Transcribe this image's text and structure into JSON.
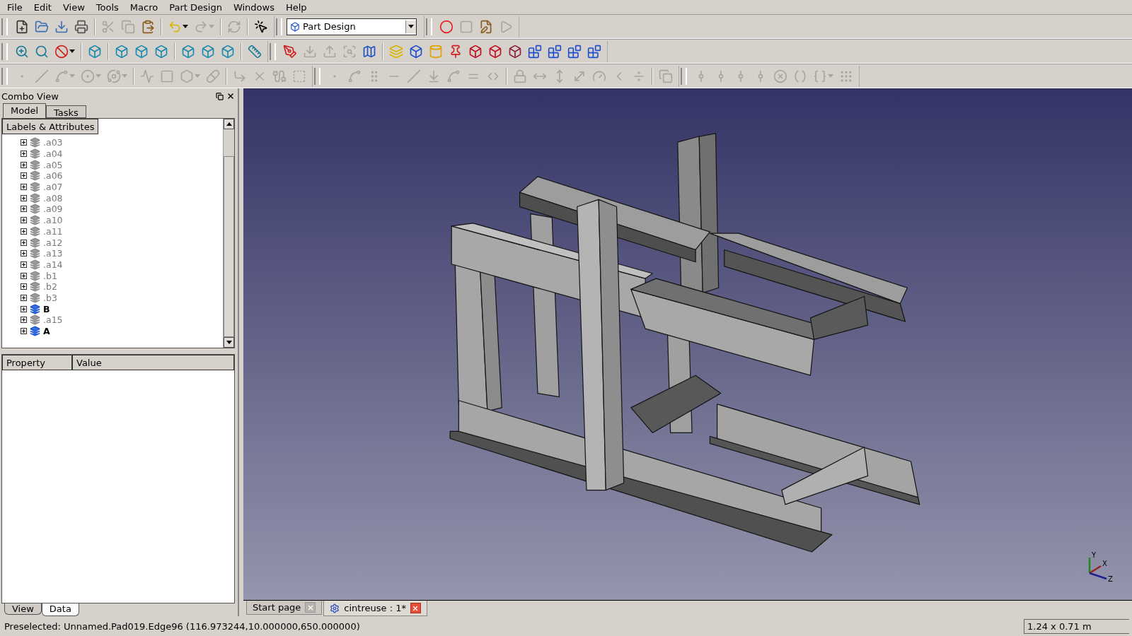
{
  "menu": [
    "File",
    "Edit",
    "View",
    "Tools",
    "Macro",
    "Part Design",
    "Windows",
    "Help"
  ],
  "toolbar_rows": [
    [
      {
        "groups": [
          [
            {
              "disabled": false,
              "dropdown": false
            },
            {
              "disabled": false,
              "dropdown": false
            },
            {
              "disabled": false,
              "dropdown": false
            },
            {
              "disabled": false,
              "dropdown": false
            }
          ],
          [
            {
              "disabled": true,
              "dropdown": false
            },
            {
              "disabled": true,
              "dropdown": false
            },
            {
              "disabled": false,
              "dropdown": false
            }
          ],
          [
            {
              "disabled": false,
              "dropdown": true
            },
            {
              "disabled": true,
              "dropdown": true
            }
          ],
          [
            {
              "disabled": true,
              "dropdown": false
            }
          ],
          [
            {
              "disabled": false,
              "dropdown": false
            }
          ]
        ]
      },
      {
        "workbench": "Part Design"
      },
      {
        "groups": [
          [
            {
              "disabled": false,
              "dropdown": false
            },
            {
              "disabled": true,
              "dropdown": false
            },
            {
              "disabled": false,
              "dropdown": false
            },
            {
              "disabled": true,
              "dropdown": false
            }
          ]
        ]
      }
    ],
    [
      {
        "groups": [
          [
            {
              "disabled": false,
              "dropdown": false
            },
            {
              "disabled": false,
              "dropdown": false
            },
            {
              "disabled": false,
              "dropdown": true
            }
          ],
          [
            {
              "disabled": false,
              "dropdown": false
            }
          ],
          [
            {
              "disabled": false,
              "dropdown": false
            },
            {
              "disabled": false,
              "dropdown": false
            },
            {
              "disabled": false,
              "dropdown": false
            }
          ],
          [
            {
              "disabled": false,
              "dropdown": false
            },
            {
              "disabled": false,
              "dropdown": false
            },
            {
              "disabled": false,
              "dropdown": false
            }
          ],
          [
            {
              "disabled": false,
              "dropdown": false
            }
          ]
        ]
      },
      {
        "groups": [
          [
            {
              "disabled": false,
              "dropdown": false
            },
            {
              "disabled": true,
              "dropdown": false
            },
            {
              "disabled": true,
              "dropdown": false
            },
            {
              "disabled": true,
              "dropdown": false
            },
            {
              "disabled": false,
              "dropdown": false
            }
          ],
          [
            {
              "disabled": false,
              "dropdown": false
            },
            {
              "disabled": false,
              "dropdown": false
            },
            {
              "disabled": false,
              "dropdown": false
            },
            {
              "disabled": false,
              "dropdown": false
            },
            {
              "disabled": false,
              "dropdown": false
            },
            {
              "disabled": false,
              "dropdown": false
            },
            {
              "disabled": false,
              "dropdown": false
            },
            {
              "disabled": false,
              "dropdown": false
            },
            {
              "disabled": false,
              "dropdown": false
            },
            {
              "disabled": false,
              "dropdown": false
            },
            {
              "disabled": false,
              "dropdown": false
            }
          ]
        ]
      }
    ],
    [
      {
        "groups": [
          [
            {
              "disabled": true,
              "dropdown": false
            },
            {
              "disabled": true,
              "dropdown": false
            },
            {
              "disabled": true,
              "dropdown": true
            },
            {
              "disabled": true,
              "dropdown": true
            },
            {
              "disabled": true,
              "dropdown": true
            }
          ],
          [
            {
              "disabled": true,
              "dropdown": false
            },
            {
              "disabled": true,
              "dropdown": false
            },
            {
              "disabled": true,
              "dropdown": true
            },
            {
              "disabled": true,
              "dropdown": false
            }
          ],
          [
            {
              "disabled": true,
              "dropdown": false
            },
            {
              "disabled": true,
              "dropdown": false
            },
            {
              "disabled": true,
              "dropdown": false
            },
            {
              "disabled": true,
              "dropdown": false
            }
          ]
        ]
      },
      {
        "groups": [
          [
            {
              "disabled": true,
              "dropdown": false
            },
            {
              "disabled": true,
              "dropdown": false
            },
            {
              "disabled": true,
              "dropdown": false
            },
            {
              "disabled": true,
              "dropdown": false
            },
            {
              "disabled": true,
              "dropdown": false
            },
            {
              "disabled": true,
              "dropdown": false
            },
            {
              "disabled": true,
              "dropdown": false
            },
            {
              "disabled": true,
              "dropdown": false
            },
            {
              "disabled": true,
              "dropdown": false
            }
          ],
          [
            {
              "disabled": true,
              "dropdown": false
            },
            {
              "disabled": true,
              "dropdown": false
            },
            {
              "disabled": true,
              "dropdown": false
            },
            {
              "disabled": true,
              "dropdown": false
            },
            {
              "disabled": true,
              "dropdown": false
            },
            {
              "disabled": true,
              "dropdown": false
            },
            {
              "disabled": true,
              "dropdown": false
            }
          ],
          [
            {
              "disabled": true,
              "dropdown": false
            }
          ]
        ]
      },
      {
        "groups": [
          [
            {
              "disabled": true,
              "dropdown": false
            },
            {
              "disabled": true,
              "dropdown": false
            },
            {
              "disabled": true,
              "dropdown": false
            },
            {
              "disabled": true,
              "dropdown": false
            },
            {
              "disabled": true,
              "dropdown": false
            },
            {
              "disabled": true,
              "dropdown": false
            },
            {
              "disabled": true,
              "dropdown": true
            },
            {
              "disabled": true,
              "dropdown": false
            }
          ]
        ]
      }
    ]
  ],
  "combo_view": {
    "title": "Combo View",
    "tabs": [
      {
        "label": "Model",
        "selected": true
      },
      {
        "label": "Tasks",
        "selected": false
      }
    ],
    "tree": {
      "header": "Labels & Attributes",
      "items": [
        {
          "label": ".a03",
          "visible": false,
          "expanded": false
        },
        {
          "label": ".a04",
          "visible": false,
          "expanded": false
        },
        {
          "label": ".a05",
          "visible": false,
          "expanded": false
        },
        {
          "label": ".a06",
          "visible": false,
          "expanded": false
        },
        {
          "label": ".a07",
          "visible": false,
          "expanded": false
        },
        {
          "label": ".a08",
          "visible": false,
          "expanded": false
        },
        {
          "label": ".a09",
          "visible": false,
          "expanded": false
        },
        {
          "label": ".a10",
          "visible": false,
          "expanded": false
        },
        {
          "label": ".a11",
          "visible": false,
          "expanded": false
        },
        {
          "label": ".a12",
          "visible": false,
          "expanded": false
        },
        {
          "label": ".a13",
          "visible": false,
          "expanded": false
        },
        {
          "label": ".a14",
          "visible": false,
          "expanded": false
        },
        {
          "label": ".b1",
          "visible": false,
          "expanded": false
        },
        {
          "label": ".b2",
          "visible": false,
          "expanded": false
        },
        {
          "label": ".b3",
          "visible": false,
          "expanded": false
        },
        {
          "label": "B",
          "visible": true,
          "expanded": false
        },
        {
          "label": ".a15",
          "visible": false,
          "expanded": false
        },
        {
          "label": "A",
          "visible": true,
          "expanded": false
        }
      ]
    },
    "property_table": {
      "columns": [
        "Property",
        "Value"
      ]
    },
    "bottom_tabs": [
      {
        "label": "View",
        "selected": false
      },
      {
        "label": "Data",
        "selected": true
      }
    ]
  },
  "viewport": {
    "axis_labels": [
      "Y",
      "X",
      "Z"
    ]
  },
  "document_tabs": [
    {
      "label": "Start page",
      "selected": false
    },
    {
      "label": "cintreuse : 1*",
      "selected": true
    }
  ],
  "status_bar": {
    "message": "Preselected: Unnamed.Pad019.Edge96 (116.973244,10.000000,650.000000)",
    "dimensions": "1.24 x 0.71 m"
  }
}
